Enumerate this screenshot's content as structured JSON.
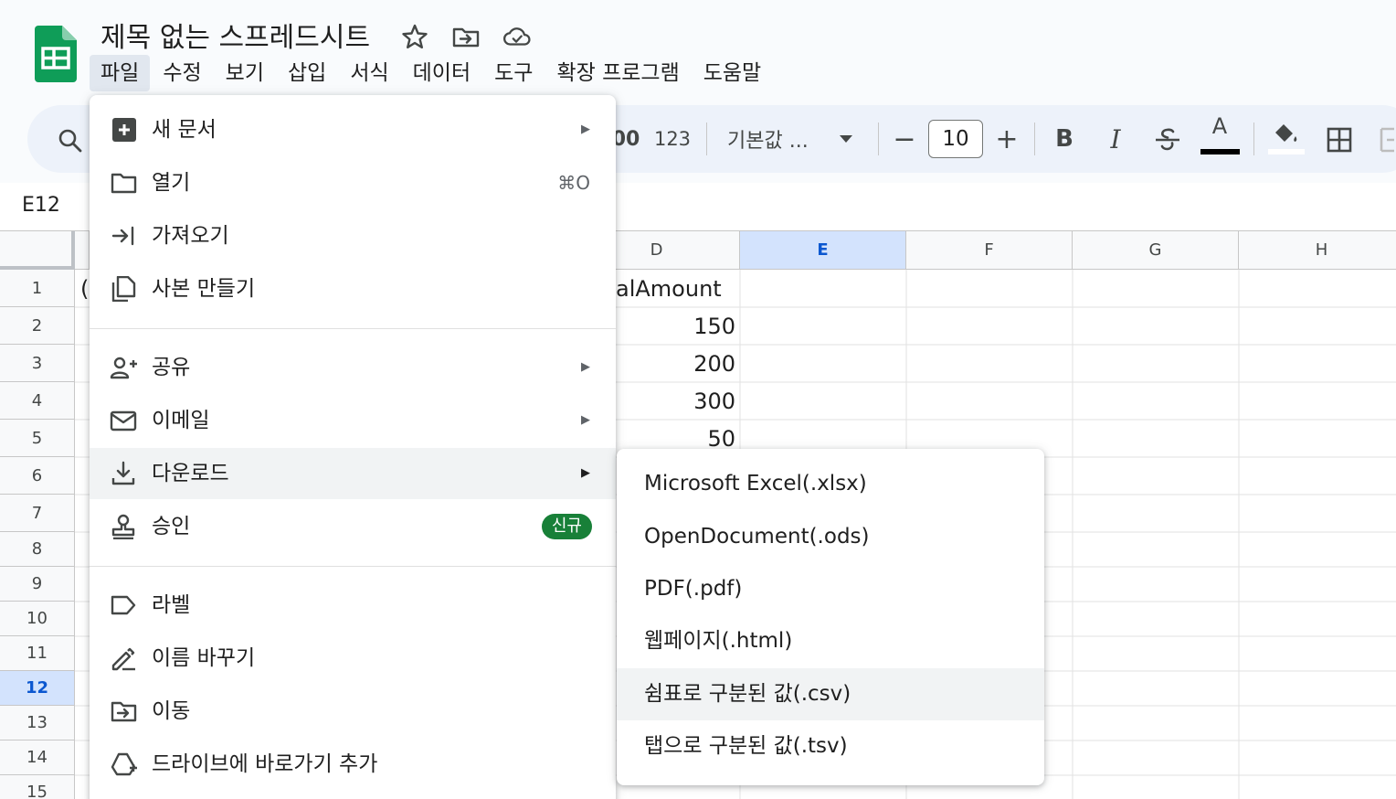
{
  "app": {
    "doc_title": "제목 없는 스프레드시트",
    "icons": [
      "sheets-logo-icon",
      "star-icon",
      "move-folder-icon",
      "cloud-status-icon"
    ],
    "brand_color": "#0f9d58"
  },
  "menubar": {
    "items": [
      "파일",
      "수정",
      "보기",
      "삽입",
      "서식",
      "데이터",
      "도구",
      "확장 프로그램",
      "도움말"
    ],
    "active": "파일"
  },
  "toolbar": {
    "format_partial": "00",
    "number_format": "123",
    "font_name": "기본값 ...",
    "font_size": "10",
    "minus": "−",
    "plus": "+",
    "bold": "B",
    "italic": "I",
    "text_color": "A"
  },
  "namebox": {
    "value": "E12"
  },
  "grid": {
    "columns": [
      "D",
      "E",
      "F",
      "G",
      "H"
    ],
    "selected_column": "E",
    "rows": [
      "1",
      "2",
      "3",
      "4",
      "5",
      "6",
      "7",
      "8",
      "9",
      "10",
      "11",
      "12",
      "13",
      "14",
      "15"
    ],
    "selected_row": "12",
    "cells": {
      "A1_partial": "(",
      "D1": "alAmount",
      "D2": "150",
      "D3": "200",
      "D4": "300",
      "D5": "50"
    }
  },
  "file_menu": {
    "items": [
      {
        "label": "새 문서",
        "icon": "new-document-icon",
        "submenu": true
      },
      {
        "label": "열기",
        "icon": "folder-open-icon",
        "shortcut": "⌘O"
      },
      {
        "label": "가져오기",
        "icon": "import-arrow-icon"
      },
      {
        "label": "사본 만들기",
        "icon": "copy-icon"
      },
      {
        "label": "공유",
        "icon": "person-add-icon",
        "submenu": true
      },
      {
        "label": "이메일",
        "icon": "email-icon",
        "submenu": true
      },
      {
        "label": "다운로드",
        "icon": "download-icon",
        "submenu": true,
        "highlighted": true
      },
      {
        "label": "승인",
        "icon": "approval-stamp-icon",
        "badge": "신규"
      },
      {
        "label": "라벨",
        "icon": "label-tag-icon"
      },
      {
        "label": "이름 바꾸기",
        "icon": "rename-pencil-icon"
      },
      {
        "label": "이동",
        "icon": "move-folder-icon"
      },
      {
        "label": "드라이브에 바로가기 추가",
        "icon": "drive-shortcut-icon"
      }
    ],
    "arrow": "▶"
  },
  "download_submenu": {
    "items": [
      {
        "label": "Microsoft Excel(.xlsx)"
      },
      {
        "label": "OpenDocument(.ods)"
      },
      {
        "label": "PDF(.pdf)"
      },
      {
        "label": "웹페이지(.html)"
      },
      {
        "label": "쉼표로 구분된 값(.csv)",
        "highlighted": true
      },
      {
        "label": "탭으로 구분된 값(.tsv)"
      }
    ]
  }
}
